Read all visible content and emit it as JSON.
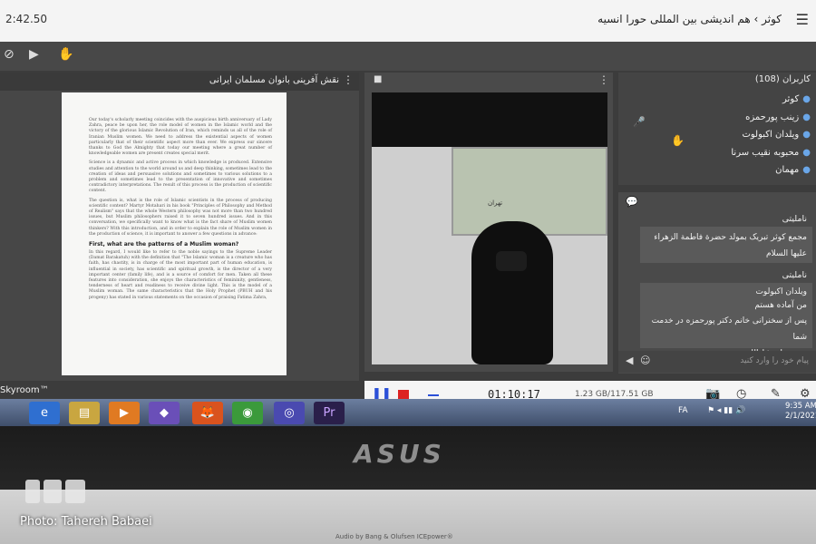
{
  "topbar": {
    "time": "2:42.50",
    "title": "کوثر › هم اندیشی بین المللی حورا انسیه"
  },
  "icons": {
    "menu": "☰",
    "cam_off": "⊘",
    "present": "▶",
    "hand": "✋",
    "dots": "⋮",
    "video": "■",
    "people": "👥",
    "mic": "🎤",
    "chat": "💬",
    "emoji": "☺",
    "send": "◀",
    "camera": "📷",
    "clock": "◷",
    "edit": "✎",
    "gear": "⚙"
  },
  "doc": {
    "title": "نقش آفرینی بانوان مسلمان ایرانی",
    "para1": "Our today's scholarly meeting coincides with the auspicious birth anniversary of Lady Zahra, peace be upon her, the role model of women in the Islamic world and the victory of the glorious Islamic Revolution of Iran, which reminds us all of the role of Iranian Muslim women. We need to address the existential aspects of women particularly that of their scientific aspect more than ever. We express our sincere thanks to God the Almighty that today our meeting where a great number of knowledgeable women are present creates special merit.",
    "para2": "Science is a dynamic and active process in which knowledge is produced. Extensive studies and attention to the world around us and deep thinking, sometimes lead to the creation of ideas and persuasive solutions and sometimes to various solutions to a problem and sometimes lead to the presentation of innovative and sometimes contradictory interpretations. The result of this process is the production of scientific content.",
    "para3": "The question is, what is the role of Islamic scientists in the process of producing scientific content? Martyr Motahari in his book \"Principles of Philosophy and Method of Realism\" says that the whole Western philosophy was not more than two hundred issues, but Muslim philosophers raised it to seven hundred issues. And in this conversation, we specifically want to know what is the fact share of Muslim women thinkers? With this introduction, and in order to explain the role of Muslim women in the production of science, it is important to answer a few questions in advance:",
    "heading": "First, what are the patterns of a Muslim woman?",
    "para4": "In this regard, I would like to refer to the noble sayings to the Supreme Leader (Damat Barakatuh) with the definition that \"The Islamic woman is a creature who has faith, has chastity, is in charge of the most important part of human education, is influential in society, has scientific and spiritual growth, is the director of a very important center (family life), and is a source of comfort for men. Taken all these features into consideration, she enjoys the characteristics of femininity, gentleness, tenderness of heart and readiness to receive divine light. This is the model of a Muslim woman. The same characteristics that the Holy Prophet (PBUH and his progeny) has stated in various statements on the occasion of praising Fatima Zahra,"
  },
  "brand": "Skyroom™",
  "video": {
    "map_label": "تهران"
  },
  "participants": {
    "header": "کاربران (108)",
    "list": [
      "کوثر",
      "زینب پورحمزه",
      "ویلدان اکبولوت",
      "محبوبه نقیب سرنا",
      "مهمان"
    ]
  },
  "chat": {
    "messages": [
      {
        "sender": "ناملیتی",
        "lines": [
          "مجمع کوثر تبریک بمولد حضرة فاطمة الزهراء",
          "علیها السلام"
        ]
      },
      {
        "sender": "ناملیتی",
        "lines": [
          "ویلدان اکبولوت",
          "من آماده هستم",
          "پس از سخنرانی خانم دکتر پورحمزه در خدمت شما",
          "هستیم ان شاءالله"
        ]
      }
    ],
    "placeholder": "پیام خود را وارد کنید"
  },
  "recorder": {
    "pause": "❚❚",
    "timer": "01:10:17",
    "size": "1.23 GB/117.51 GB"
  },
  "taskbar": {
    "apps": [
      "e",
      "▤",
      "▶",
      "◆",
      "🦊",
      "◉",
      "◎",
      "Pr"
    ],
    "lang": "FA",
    "tray": "⚑ ◂ ▮▮ 🔊",
    "time": "9:35 AM",
    "date": "2/1/2021"
  },
  "laptop": {
    "brand": "ASUS",
    "audio": "Audio by Bang & Olufsen ICEpower®"
  },
  "credit": "Photo: Tahereh Babaei",
  "colors": {
    "record_red": "#dd2222",
    "accent_blue": "#2b50d8",
    "user_blue": "#6aa6e8"
  }
}
